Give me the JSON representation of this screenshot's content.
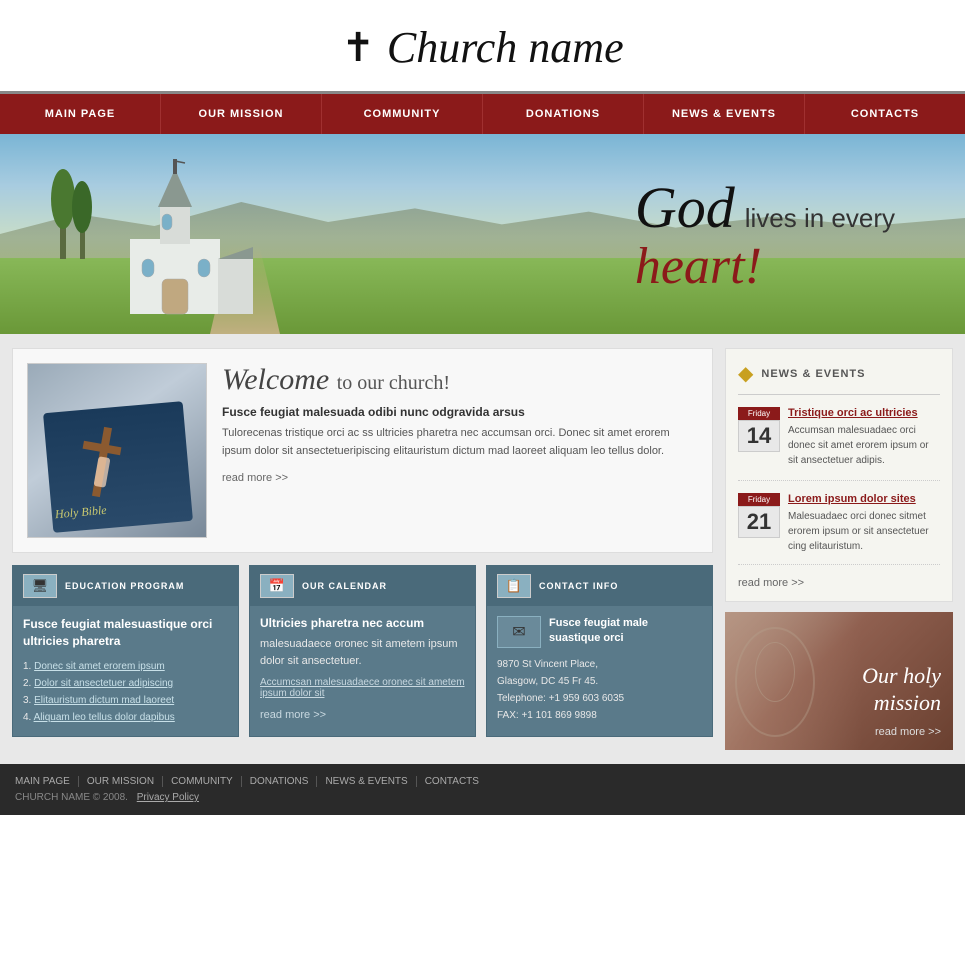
{
  "header": {
    "title": "Church name",
    "cross": "✝"
  },
  "nav": {
    "items": [
      {
        "label": "MAIN PAGE",
        "id": "main-page"
      },
      {
        "label": "OUR MISSION",
        "id": "our-mission"
      },
      {
        "label": "COMMUNITY",
        "id": "community"
      },
      {
        "label": "DONATIONS",
        "id": "donations"
      },
      {
        "label": "NEWS & EVENTS",
        "id": "news-events"
      },
      {
        "label": "CONTACTS",
        "id": "contacts"
      }
    ]
  },
  "hero": {
    "text1": "God",
    "text2": "lives in every",
    "text3": "heart!"
  },
  "welcome": {
    "heading_italic": "Welcome",
    "heading_normal": "to our church!",
    "subheading": "Fusce feugiat malesuada odibi nunc odgravida arsus",
    "body": "Tulorecenas tristique orci ac ss ultricies pharetra nec accumsan orci. Donec sit amet erorem ipsum dolor sit ansectetueripiscing elitauristum dictum mad laoreet aliquam leo tellus dolor.",
    "read_more": "read more >>"
  },
  "education_box": {
    "title": "EDUCATION PROGRAM",
    "heading": "Fusce feugiat malesuastique orci ultricies pharetra",
    "intro": "",
    "links": [
      "Donec sit amet erorem ipsum",
      "Dolor sit ansectetuer adipiscing",
      "Elitauristum dictum mad laoreet",
      "Aliquam leo tellus dolor dapibus"
    ]
  },
  "calendar_box": {
    "title": "OUR CALENDAR",
    "heading": "Ultricies pharetra nec accum",
    "body": "malesuadaece oronec sit ametem ipsum dolor sit ansectetuer.",
    "link_text": "Accumcsan malesuadaece oronec sit ametem ipsum dolor sit",
    "read_more": "read more >>"
  },
  "contact_box": {
    "title": "CONTACT INFO",
    "heading": "Fusce feugiat male suastique orci",
    "address": "9870 St Vincent Place,\nGlasgow, DC 45 Fr 45.",
    "phone": "Telephone:  +1 959 603 6035",
    "fax": "FAX:         +1 101 869 9898"
  },
  "news_events": {
    "title": "NEWS & EVENTS",
    "items": [
      {
        "day_label": "Friday",
        "day_num": "14",
        "title": "Tristique orci ac ultricies",
        "body": "Accumsan malesuadaec orci donec sit amet erorem ipsum or sit ansectetuer adipis."
      },
      {
        "day_label": "Friday",
        "day_num": "21",
        "title": "Lorem ipsum dolor sites",
        "body": "Malesuadaec orci donec sitmet erorem ipsum or sit ansectetuer cing elitauristum."
      }
    ],
    "read_more": "read more >>"
  },
  "mission": {
    "title_line1": "Our holy",
    "title_line2": "mission",
    "read_more": "read more >>"
  },
  "footer": {
    "nav_items": [
      "MAIN PAGE",
      "OUR MISSION",
      "COMMUNITY",
      "DONATIONS",
      "NEWS & EVENTS",
      "CONTACTS"
    ],
    "copyright": "CHURCH NAME © 2008.",
    "privacy": "Privacy Policy"
  }
}
